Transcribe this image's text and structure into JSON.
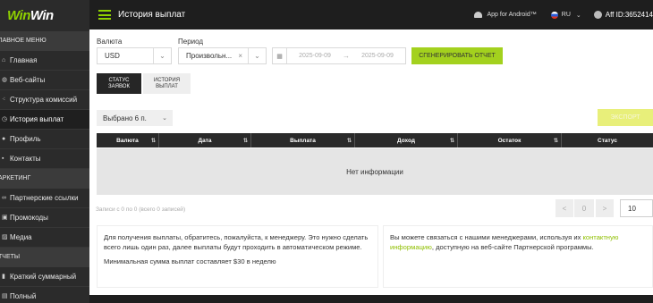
{
  "brand": {
    "part1": "Win",
    "part2": "Win"
  },
  "topbar": {
    "title": "История выплат",
    "android": "App for Android™",
    "lang": "RU",
    "aff_id": "Aff ID:3652414"
  },
  "sidebar": {
    "sections": [
      {
        "header": "ЛАВНОЕ МЕНЮ",
        "items": [
          {
            "label": "Главная",
            "active": false
          },
          {
            "label": "Веб-сайты",
            "active": false
          },
          {
            "label": "Структура комиссий",
            "active": false
          },
          {
            "label": "История выплат",
            "active": true
          },
          {
            "label": "Профиль",
            "active": false
          },
          {
            "label": "Контакты",
            "active": false
          }
        ]
      },
      {
        "header": "АРКЕТИНГ",
        "items": [
          {
            "label": "Партнерские ссылки",
            "active": false
          },
          {
            "label": "Промокоды",
            "active": false
          },
          {
            "label": "Медиа",
            "active": false
          }
        ]
      },
      {
        "header": "ТЧЕТЫ",
        "items": [
          {
            "label": "Краткий суммарный",
            "active": false
          },
          {
            "label": "Полный",
            "active": false
          }
        ]
      }
    ]
  },
  "filters": {
    "currency_label": "Валюта",
    "currency_value": "USD",
    "period_label": "Период",
    "period_value": "Произвольн...",
    "date_from": "2025-09-09",
    "date_to": "2025-09-09",
    "generate_label": "СГЕНЕРИРОВАТЬ ОТЧЕТ"
  },
  "tabs": [
    {
      "line1": "СТАТУС",
      "line2": "ЗАЯВОК",
      "active": true
    },
    {
      "line1": "ИСТОРИЯ",
      "line2": "ВЫПЛАТ",
      "active": false
    }
  ],
  "selected_label": "Выбрано 6 п.",
  "export_label": "ЭКСПОРТ",
  "table": {
    "columns": [
      "Валюта",
      "Дата",
      "Выплата",
      "Доход",
      "Остаток",
      "Статус"
    ],
    "empty_text": "Нет информации"
  },
  "records_text": "Записи с 0 по 0 (всего 0 записей)",
  "pager": {
    "prev": "<",
    "page": "0",
    "next": ">",
    "per_page": "10"
  },
  "info": {
    "left_p1": "Для получения выплаты, обратитесь, пожалуйста, к менеджеру. Это нужно сделать всего лишь один раз, далее выплаты будут проходить в автоматическом режиме.",
    "left_p2": "Минимальная сумма выплат составляет $30 в неделю",
    "right_before": "Вы можете связаться с нашими менеджерами, используя их ",
    "right_link": "контактную информацию",
    "right_after": ", доступную на веб-сайте Партнерской программы."
  }
}
